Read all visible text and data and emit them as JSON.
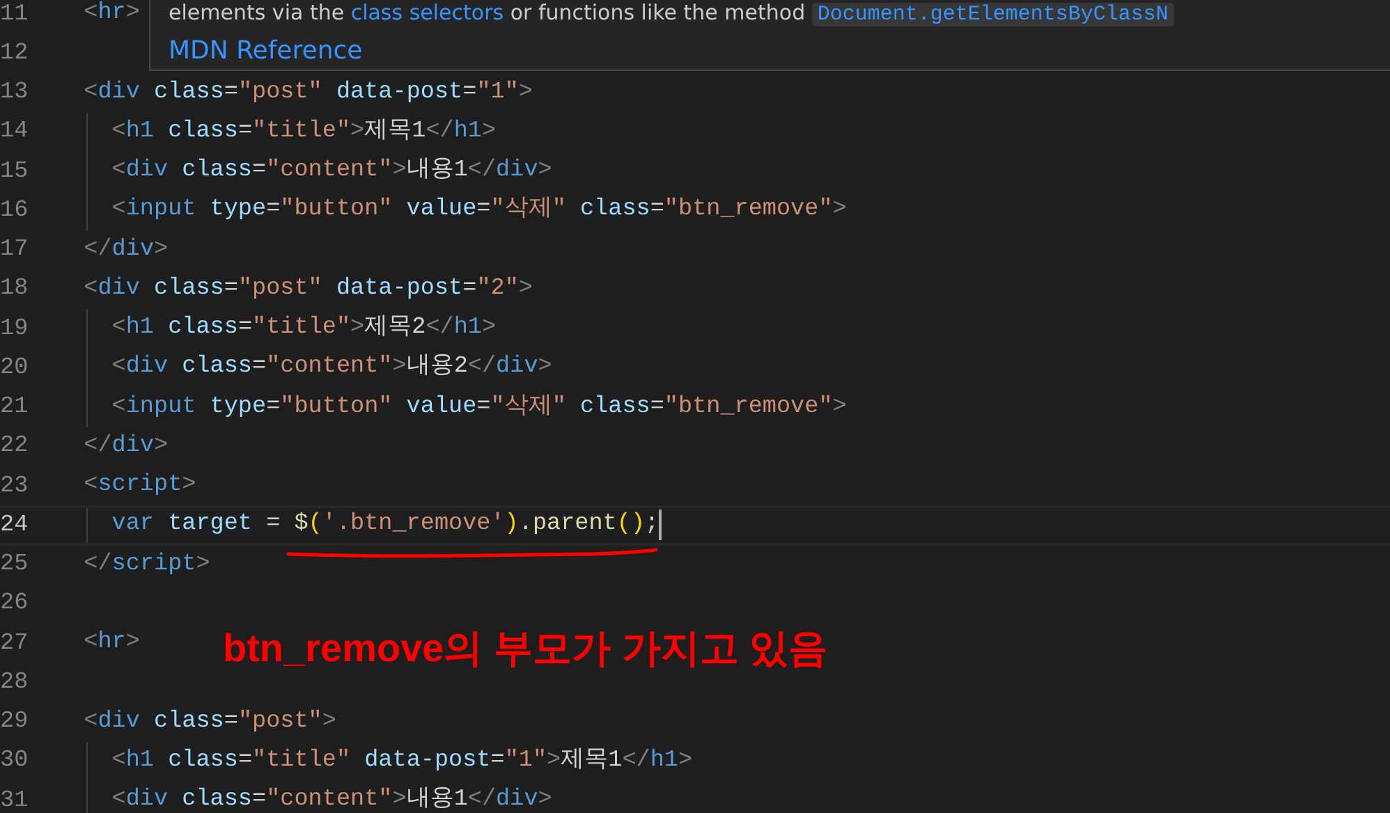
{
  "tooltip": {
    "description": [
      {
        "kind": "text",
        "text": "elements via the "
      },
      {
        "kind": "link",
        "text": "class selectors"
      },
      {
        "kind": "text",
        "text": " or functions like the method "
      }
    ],
    "code": "Document.getElementsByClassN",
    "link": "MDN Reference"
  },
  "lines": [
    {
      "number": "11",
      "current": false,
      "tokens": [
        {
          "kind": "punct",
          "text": "  <"
        },
        {
          "kind": "tag",
          "text": "hr"
        },
        {
          "kind": "punct",
          "text": ">"
        }
      ]
    },
    {
      "number": "12",
      "current": false
    },
    {
      "number": "13",
      "current": false,
      "tokens": [
        {
          "kind": "punct",
          "text": "  <"
        },
        {
          "kind": "tag",
          "text": "div"
        },
        {
          "kind": "attr",
          "text": " class"
        },
        {
          "kind": "text",
          "text": "="
        },
        {
          "kind": "string",
          "text": "\"post\""
        },
        {
          "kind": "attr",
          "text": " data-post"
        },
        {
          "kind": "text",
          "text": "="
        },
        {
          "kind": "string",
          "text": "\"1\""
        },
        {
          "kind": "punct",
          "text": ">"
        }
      ]
    },
    {
      "number": "14",
      "current": false,
      "tokens": [
        {
          "kind": "punct",
          "text": "    <"
        },
        {
          "kind": "tag",
          "text": "h1"
        },
        {
          "kind": "attr",
          "text": " class"
        },
        {
          "kind": "text",
          "text": "="
        },
        {
          "kind": "string",
          "text": "\"title\""
        },
        {
          "kind": "punct",
          "text": ">"
        },
        {
          "kind": "text",
          "text": "제목1"
        },
        {
          "kind": "punct",
          "text": "</"
        },
        {
          "kind": "tag",
          "text": "h1"
        },
        {
          "kind": "punct",
          "text": ">"
        }
      ]
    },
    {
      "number": "15",
      "current": false,
      "tokens": [
        {
          "kind": "punct",
          "text": "    <"
        },
        {
          "kind": "tag",
          "text": "div"
        },
        {
          "kind": "attr",
          "text": " class"
        },
        {
          "kind": "text",
          "text": "="
        },
        {
          "kind": "string",
          "text": "\"content\""
        },
        {
          "kind": "punct",
          "text": ">"
        },
        {
          "kind": "text",
          "text": "내용1"
        },
        {
          "kind": "punct",
          "text": "</"
        },
        {
          "kind": "tag",
          "text": "div"
        },
        {
          "kind": "punct",
          "text": ">"
        }
      ]
    },
    {
      "number": "16",
      "current": false,
      "tokens": [
        {
          "kind": "punct",
          "text": "    <"
        },
        {
          "kind": "tag",
          "text": "input"
        },
        {
          "kind": "attr",
          "text": " type"
        },
        {
          "kind": "text",
          "text": "="
        },
        {
          "kind": "string",
          "text": "\"button\""
        },
        {
          "kind": "attr",
          "text": " value"
        },
        {
          "kind": "text",
          "text": "="
        },
        {
          "kind": "string",
          "text": "\"삭제\""
        },
        {
          "kind": "attr",
          "text": " class"
        },
        {
          "kind": "text",
          "text": "="
        },
        {
          "kind": "string",
          "text": "\"btn_remove\""
        },
        {
          "kind": "punct",
          "text": ">"
        }
      ]
    },
    {
      "number": "17",
      "current": false,
      "tokens": [
        {
          "kind": "punct",
          "text": "  </"
        },
        {
          "kind": "tag",
          "text": "div"
        },
        {
          "kind": "punct",
          "text": ">"
        }
      ]
    },
    {
      "number": "18",
      "current": false,
      "tokens": [
        {
          "kind": "punct",
          "text": "  <"
        },
        {
          "kind": "tag",
          "text": "div"
        },
        {
          "kind": "attr",
          "text": " class"
        },
        {
          "kind": "text",
          "text": "="
        },
        {
          "kind": "string",
          "text": "\"post\""
        },
        {
          "kind": "attr",
          "text": " data-post"
        },
        {
          "kind": "text",
          "text": "="
        },
        {
          "kind": "string",
          "text": "\"2\""
        },
        {
          "kind": "punct",
          "text": ">"
        }
      ]
    },
    {
      "number": "19",
      "current": false,
      "tokens": [
        {
          "kind": "punct",
          "text": "    <"
        },
        {
          "kind": "tag",
          "text": "h1"
        },
        {
          "kind": "attr",
          "text": " class"
        },
        {
          "kind": "text",
          "text": "="
        },
        {
          "kind": "string",
          "text": "\"title\""
        },
        {
          "kind": "punct",
          "text": ">"
        },
        {
          "kind": "text",
          "text": "제목2"
        },
        {
          "kind": "punct",
          "text": "</"
        },
        {
          "kind": "tag",
          "text": "h1"
        },
        {
          "kind": "punct",
          "text": ">"
        }
      ]
    },
    {
      "number": "20",
      "current": false,
      "tokens": [
        {
          "kind": "punct",
          "text": "    <"
        },
        {
          "kind": "tag",
          "text": "div"
        },
        {
          "kind": "attr",
          "text": " class"
        },
        {
          "kind": "text",
          "text": "="
        },
        {
          "kind": "string",
          "text": "\"content\""
        },
        {
          "kind": "punct",
          "text": ">"
        },
        {
          "kind": "text",
          "text": "내용2"
        },
        {
          "kind": "punct",
          "text": "</"
        },
        {
          "kind": "tag",
          "text": "div"
        },
        {
          "kind": "punct",
          "text": ">"
        }
      ]
    },
    {
      "number": "21",
      "current": false,
      "tokens": [
        {
          "kind": "punct",
          "text": "    <"
        },
        {
          "kind": "tag",
          "text": "input"
        },
        {
          "kind": "attr",
          "text": " type"
        },
        {
          "kind": "text",
          "text": "="
        },
        {
          "kind": "string",
          "text": "\"button\""
        },
        {
          "kind": "attr",
          "text": " value"
        },
        {
          "kind": "text",
          "text": "="
        },
        {
          "kind": "string",
          "text": "\"삭제\""
        },
        {
          "kind": "attr",
          "text": " class"
        },
        {
          "kind": "text",
          "text": "="
        },
        {
          "kind": "string",
          "text": "\"btn_remove\""
        },
        {
          "kind": "punct",
          "text": ">"
        }
      ]
    },
    {
      "number": "22",
      "current": false,
      "tokens": [
        {
          "kind": "punct",
          "text": "  </"
        },
        {
          "kind": "tag",
          "text": "div"
        },
        {
          "kind": "punct",
          "text": ">"
        }
      ]
    },
    {
      "number": "23",
      "current": false,
      "tokens": [
        {
          "kind": "punct",
          "text": "  <"
        },
        {
          "kind": "tag",
          "text": "script"
        },
        {
          "kind": "punct",
          "text": ">"
        }
      ]
    },
    {
      "number": "24",
      "current": true,
      "tokens": [
        {
          "kind": "keyword",
          "text": "    var"
        },
        {
          "kind": "variable",
          "text": " target"
        },
        {
          "kind": "text",
          "text": " = "
        },
        {
          "kind": "function",
          "text": "$"
        },
        {
          "kind": "bracket",
          "text": "("
        },
        {
          "kind": "string",
          "text": "'.btn_remove'"
        },
        {
          "kind": "bracket",
          "text": ")"
        },
        {
          "kind": "text",
          "text": "."
        },
        {
          "kind": "function",
          "text": "parent"
        },
        {
          "kind": "bracket",
          "text": "()"
        },
        {
          "kind": "text",
          "text": ";"
        }
      ]
    },
    {
      "number": "25",
      "current": false,
      "tokens": [
        {
          "kind": "punct",
          "text": "  </"
        },
        {
          "kind": "tag",
          "text": "script"
        },
        {
          "kind": "punct",
          "text": ">"
        }
      ]
    },
    {
      "number": "26",
      "current": false
    },
    {
      "number": "27",
      "current": false,
      "tokens": [
        {
          "kind": "punct",
          "text": "  <"
        },
        {
          "kind": "tag",
          "text": "hr"
        },
        {
          "kind": "punct",
          "text": ">"
        }
      ]
    },
    {
      "number": "28",
      "current": false
    },
    {
      "number": "29",
      "current": false,
      "tokens": [
        {
          "kind": "punct",
          "text": "  <"
        },
        {
          "kind": "tag",
          "text": "div"
        },
        {
          "kind": "attr",
          "text": " class"
        },
        {
          "kind": "text",
          "text": "="
        },
        {
          "kind": "string",
          "text": "\"post\""
        },
        {
          "kind": "punct",
          "text": ">"
        }
      ]
    },
    {
      "number": "30",
      "current": false,
      "tokens": [
        {
          "kind": "punct",
          "text": "    <"
        },
        {
          "kind": "tag",
          "text": "h1"
        },
        {
          "kind": "attr",
          "text": " class"
        },
        {
          "kind": "text",
          "text": "="
        },
        {
          "kind": "string",
          "text": "\"title\""
        },
        {
          "kind": "attr",
          "text": " data-post"
        },
        {
          "kind": "text",
          "text": "="
        },
        {
          "kind": "string",
          "text": "\"1\""
        },
        {
          "kind": "punct",
          "text": ">"
        },
        {
          "kind": "text",
          "text": "제목1"
        },
        {
          "kind": "punct",
          "text": "</"
        },
        {
          "kind": "tag",
          "text": "h1"
        },
        {
          "kind": "punct",
          "text": ">"
        }
      ]
    },
    {
      "number": "31",
      "current": false,
      "tokens": [
        {
          "kind": "punct",
          "text": "    <"
        },
        {
          "kind": "tag",
          "text": "div"
        },
        {
          "kind": "attr",
          "text": " class"
        },
        {
          "kind": "text",
          "text": "="
        },
        {
          "kind": "string",
          "text": "\"content\""
        },
        {
          "kind": "punct",
          "text": ">"
        },
        {
          "kind": "text",
          "text": "내용1"
        },
        {
          "kind": "punct",
          "text": "</"
        },
        {
          "kind": "tag",
          "text": "div"
        },
        {
          "kind": "punct",
          "text": ">"
        }
      ]
    }
  ],
  "annotation": {
    "text": "btn_remove의 부모가 가지고 있음"
  }
}
